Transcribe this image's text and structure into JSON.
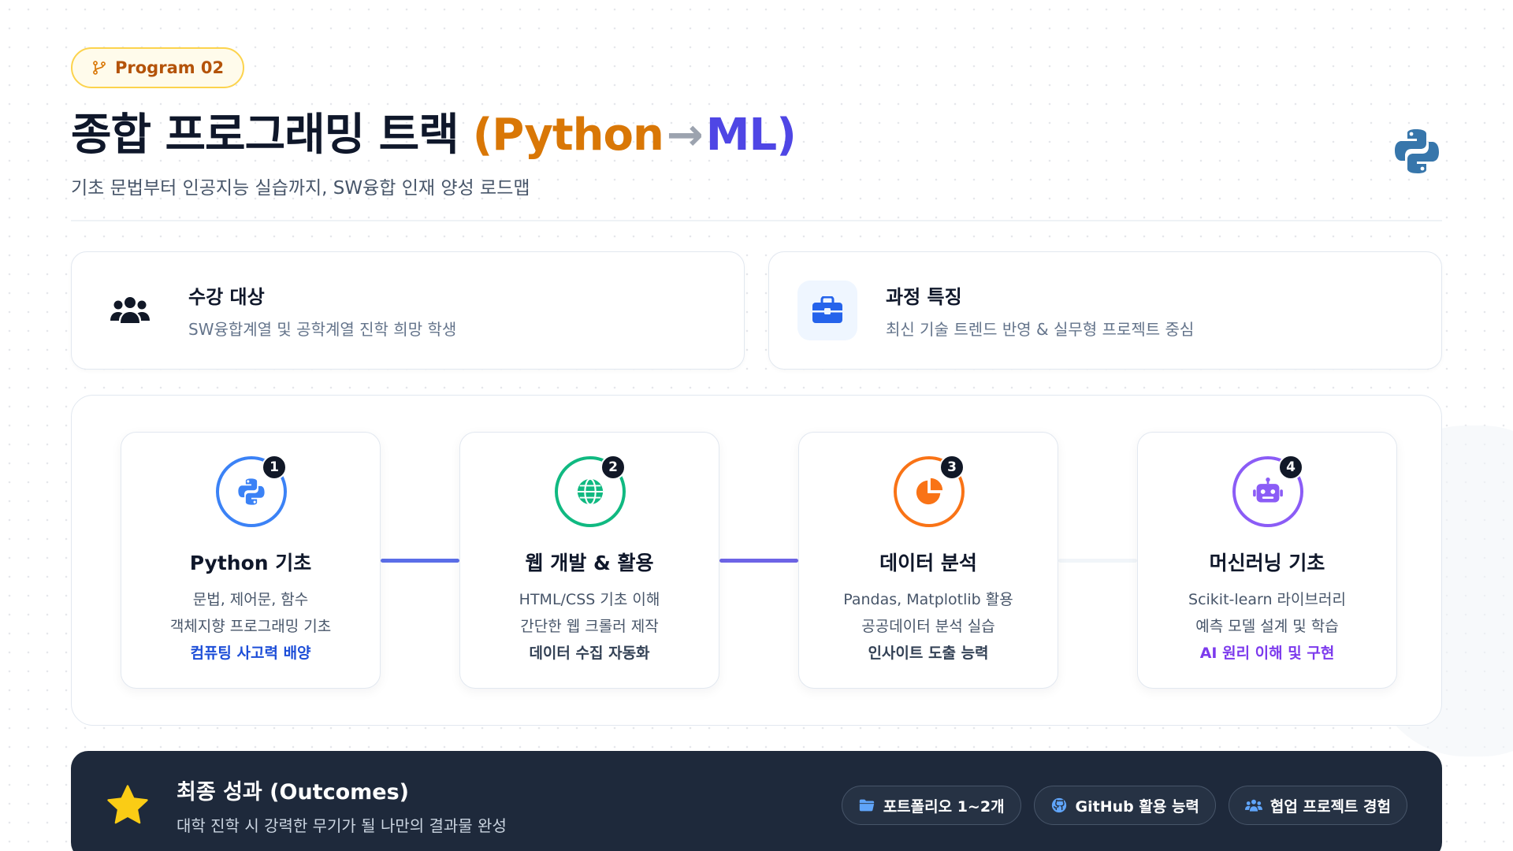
{
  "header": {
    "badge_label": "Program 02",
    "title_main": "종합 프로그래밍 트랙",
    "title_paren_open": "(",
    "title_python": "Python",
    "title_arrow": "→",
    "title_ml": "ML",
    "title_paren_close": ")",
    "subtitle": "기초 문법부터 인공지능 실습까지, SW융합 인재 양성 로드맵"
  },
  "info_cards": [
    {
      "title": "수강 대상",
      "desc": "SW융합계열 및 공학계열 진학 희망 학생",
      "icon": "users-icon"
    },
    {
      "title": "과정 특징",
      "desc": "최신 기술 트렌드 반영 & 실무형 프로젝트 중심",
      "icon": "briefcase-icon"
    }
  ],
  "steps": [
    {
      "num": "1",
      "title": "Python 기초",
      "line1": "문법, 제어문, 함수",
      "line2": "객체지향 프로그래밍 기초",
      "line3": "컴퓨팅 사고력 배양",
      "color": "#3b82f6",
      "accent_text": "#1d4ed8",
      "icon": "python-icon"
    },
    {
      "num": "2",
      "title": "웹 개발 & 활용",
      "line1": "HTML/CSS 기초 이해",
      "line2": "간단한 웹 크롤러 제작",
      "line3": "데이터 수집 자동화",
      "color": "#10b981",
      "accent_text": "#334155",
      "icon": "globe-icon"
    },
    {
      "num": "3",
      "title": "데이터 분석",
      "line1": "Pandas, Matplotlib 활용",
      "line2": "공공데이터 분석 실습",
      "line3": "인사이트 도출 능력",
      "color": "#f97316",
      "accent_text": "#334155",
      "icon": "pie-chart-icon"
    },
    {
      "num": "4",
      "title": "머신러닝 기초",
      "line1": "Scikit-learn 라이브러리",
      "line2": "예측 모델 설계 및 학습",
      "line3": "AI 원리 이해 및 구현",
      "color": "#8b5cf6",
      "accent_text": "#7c3aed",
      "icon": "robot-icon"
    }
  ],
  "outcome": {
    "title": "최종 성과 (Outcomes)",
    "desc": "대학 진학 시 강력한 무기가 될 나만의 결과물 완성",
    "pills": [
      {
        "label": "포트폴리오 1~2개",
        "icon": "folder-icon"
      },
      {
        "label": "GitHub 활용 능력",
        "icon": "github-icon"
      },
      {
        "label": "협업 프로젝트 경험",
        "icon": "team-icon"
      }
    ]
  },
  "colors": {
    "amber": "#d97706",
    "indigo": "#4f46e5",
    "dark_panel": "#1e293b",
    "star": "#facc15"
  }
}
